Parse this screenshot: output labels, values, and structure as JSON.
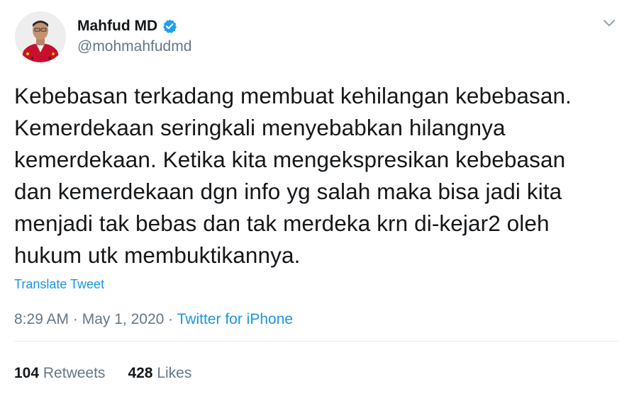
{
  "author": {
    "display_name": "Mahfud MD",
    "handle": "@mohmahfudmd",
    "verified": true
  },
  "tweet": {
    "text": "Kebebasan terkadang membuat kehilangan kebebasan.\nKemerdekaan seringkali menyebabkan hilangnya\nkemerdekaan. Ketika kita mengekspresikan kebebasan\ndan kemerdekaan dgn info yg salah maka bisa jadi kita\nmenjadi tak bebas dan tak merdeka krn di-kejar2 oleh\nhukum utk membuktikannya.",
    "translate_label": "Translate Tweet",
    "time": "8:29 AM",
    "separator": "·",
    "date": "May 1, 2020",
    "source": "Twitter for iPhone"
  },
  "stats": {
    "retweets_count": "104",
    "retweets_label": "Retweets",
    "likes_count": "428",
    "likes_label": "Likes"
  },
  "icons": {
    "verified": "verified-badge-icon",
    "menu": "chevron-down-icon"
  },
  "colors": {
    "link": "#1b95e0",
    "verified": "#1da1f2",
    "text": "#14171a",
    "muted": "#657786"
  }
}
